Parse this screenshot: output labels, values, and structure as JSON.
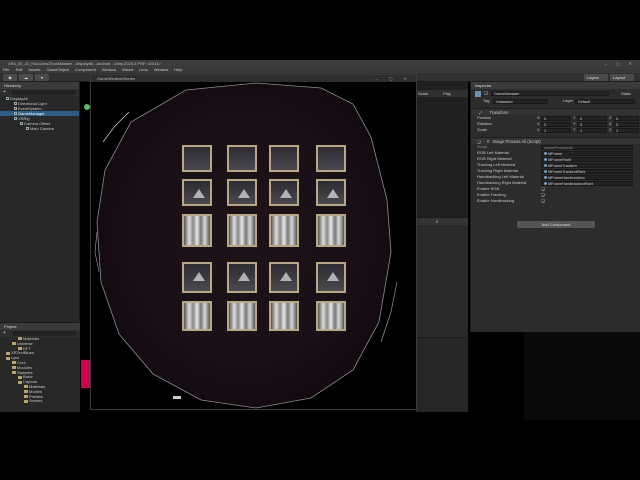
{
  "window_title": "XR3_02_21_HaloLens2ToolsMaster - DisplayAll - Android - Unity 2020.3 PRF <DX11>",
  "menu": [
    "File",
    "Edit",
    "Assets",
    "GameObject",
    "Component",
    "Window",
    "Mixed",
    "Lens",
    "Window",
    "Help"
  ],
  "toolbar": {
    "layers": "Layers",
    "layout": "Layout"
  },
  "hierarchy": {
    "tab": "Hierarchy",
    "items": [
      {
        "label": "DisplayAll",
        "depth": 0
      },
      {
        "label": "Directional Light",
        "depth": 1
      },
      {
        "label": "EventSystem",
        "depth": 1
      },
      {
        "label": "GameManager",
        "depth": 1,
        "selected": true
      },
      {
        "label": "XRRig",
        "depth": 1
      },
      {
        "label": "Camera Offset",
        "depth": 2
      },
      {
        "label": "Main Camera",
        "depth": 3
      }
    ]
  },
  "project": {
    "tab": "Project",
    "items": [
      {
        "label": "Materials",
        "depth": 2
      },
      {
        "label": "Universe",
        "depth": 1
      },
      {
        "label": "DFT",
        "depth": 2
      },
      {
        "label": "XRTextBlues",
        "depth": 0
      },
      {
        "label": "Lynx",
        "depth": 0
      },
      {
        "label": "Core",
        "depth": 1
      },
      {
        "label": "Modules",
        "depth": 1
      },
      {
        "label": "Samples",
        "depth": 1
      },
      {
        "label": "Basic",
        "depth": 2
      },
      {
        "label": "Capture",
        "depth": 2
      },
      {
        "label": "Materials",
        "depth": 3
      },
      {
        "label": "Models",
        "depth": 3
      },
      {
        "label": "Prefabs",
        "depth": 3
      },
      {
        "label": "Scenes",
        "depth": 3
      }
    ]
  },
  "game_window": {
    "title": "GameWindowStream"
  },
  "side_panels": {
    "scale_label": "Scale",
    "play_label": "Play",
    "count_label": "9"
  },
  "inspector": {
    "tab": "Inspector",
    "object_name": "GameManager",
    "static_label": "Static",
    "tag_label": "Tag",
    "tag_value": "Untagged",
    "layer_label": "Layer",
    "layer_value": "Default",
    "transform": {
      "title": "Transform",
      "rows": [
        {
          "label": "Position",
          "x": "0",
          "y": "0",
          "z": "0"
        },
        {
          "label": "Rotation",
          "x": "0",
          "y": "0",
          "z": "0"
        },
        {
          "label": "Scale",
          "x": "1",
          "y": "1",
          "z": "1"
        }
      ]
    },
    "script": {
      "title": "Image Process All (Script)",
      "script_label": "Script",
      "script_value": "ImageProcessAll",
      "fields": [
        {
          "label": "RGB Left Material",
          "value": "MFrame"
        },
        {
          "label": "RGB Right Material",
          "value": "MFrameRight"
        },
        {
          "label": "Tracking Left Material",
          "value": "MFrameTracking"
        },
        {
          "label": "Tracking Right Material",
          "value": "MFrameTrackingRight"
        },
        {
          "label": "Handtracking Left Material",
          "value": "MFrameHandtracking"
        },
        {
          "label": "Handtracking Right Material",
          "value": "MFrameHandtrackingRight"
        }
      ],
      "toggles": [
        {
          "label": "Enable RGB",
          "checked": "✓"
        },
        {
          "label": "Enable Tracking",
          "checked": "✓"
        },
        {
          "label": "Enable Handtracking",
          "checked": "✓"
        }
      ]
    },
    "add_component": "Add Component"
  },
  "grid_tiles": {
    "rows": [
      [
        "dim",
        "dim",
        "dim",
        "dim"
      ],
      [
        "tri",
        "tri",
        "tri",
        "tri"
      ],
      [
        "bright",
        "bright",
        "bright",
        "bright"
      ],
      [
        "tri",
        "tri",
        "tri",
        "tri"
      ],
      [
        "bright",
        "bright",
        "bright",
        "bright"
      ]
    ]
  }
}
